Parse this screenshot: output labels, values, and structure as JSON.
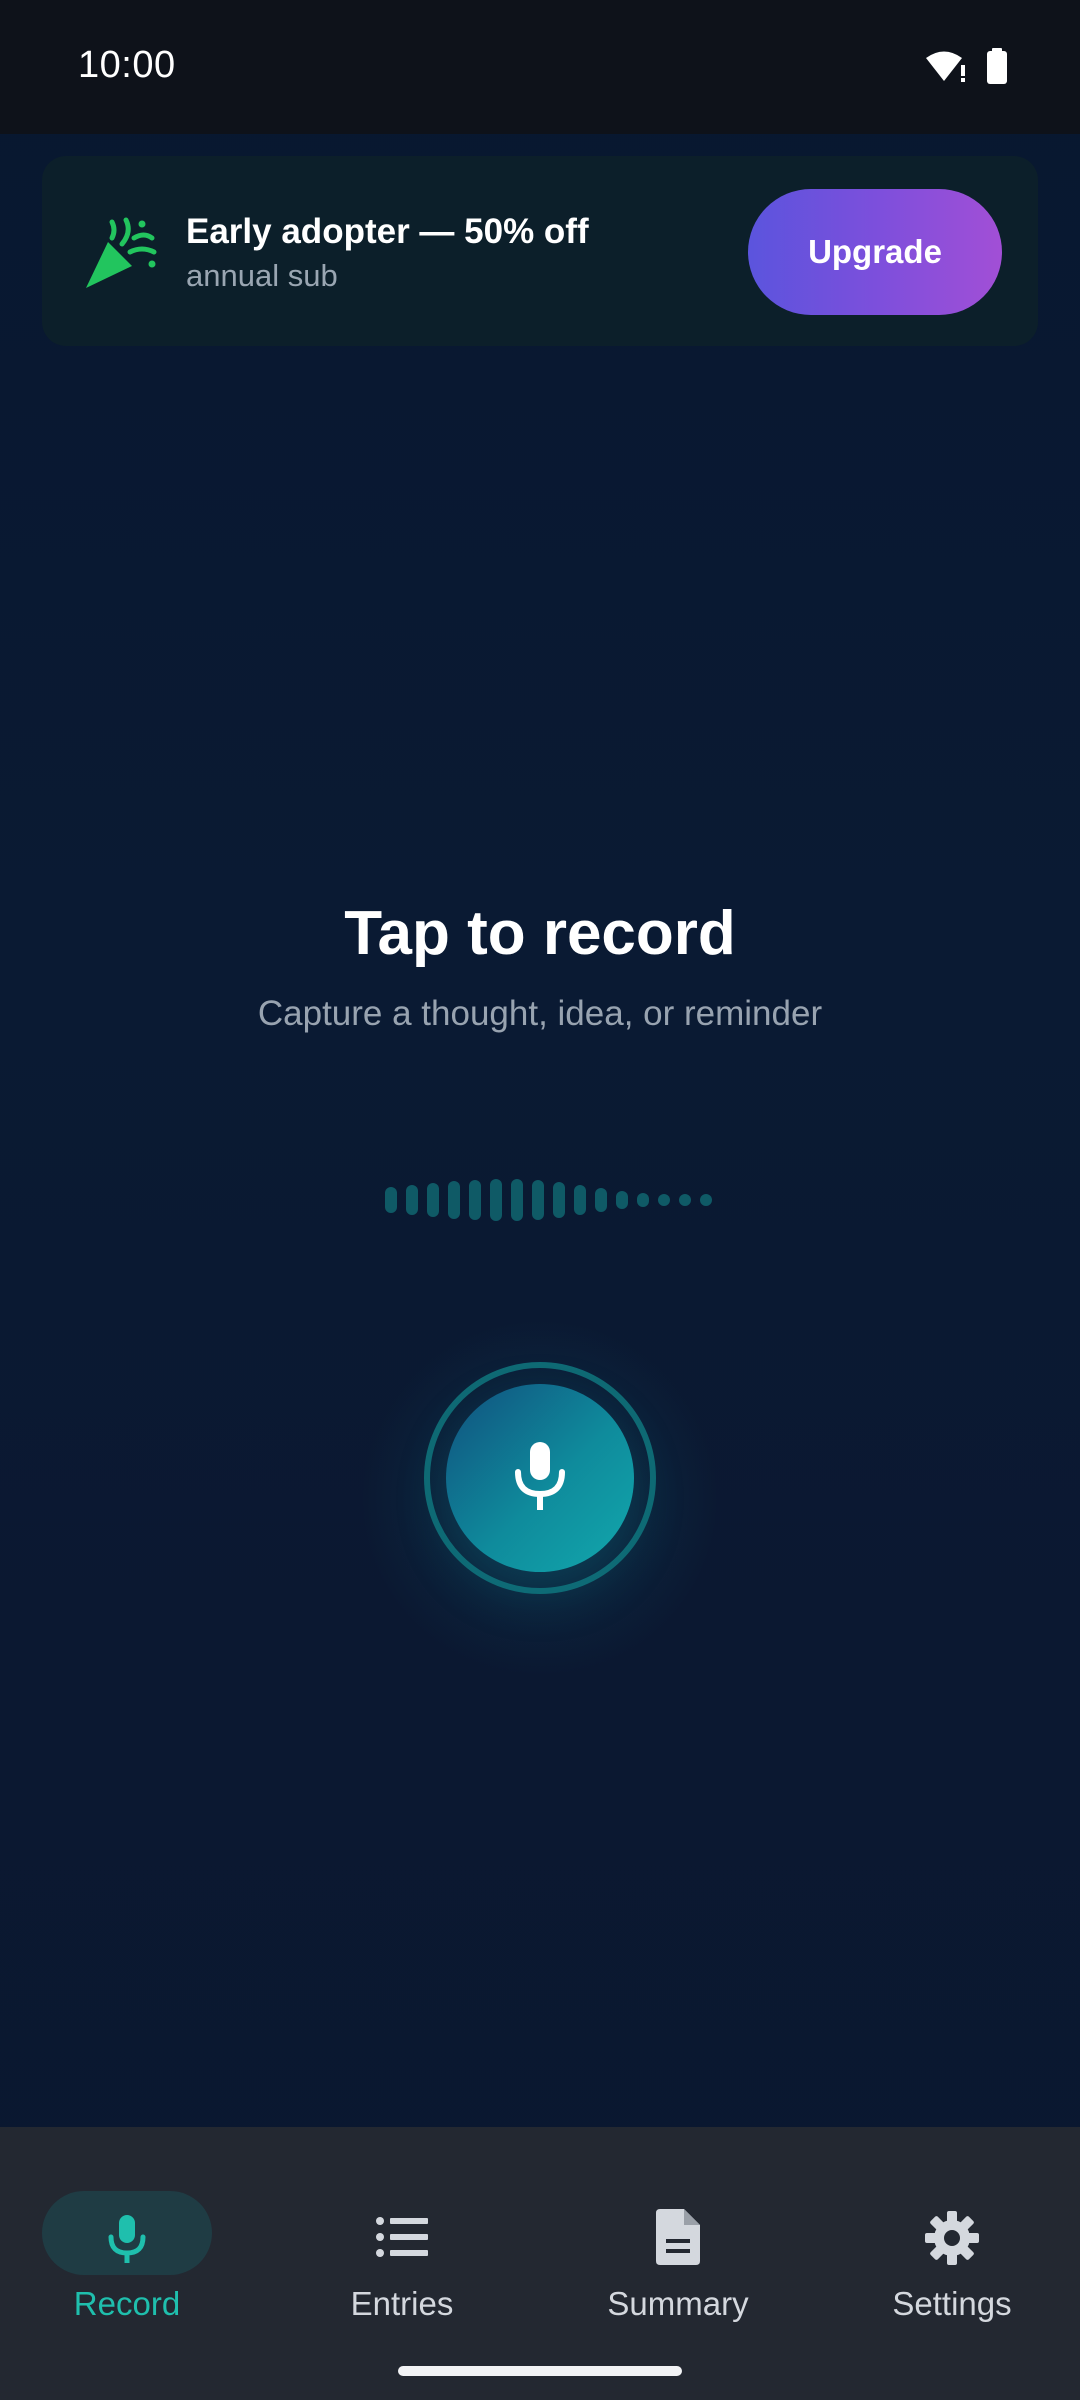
{
  "status_bar": {
    "time": "10:00",
    "icons": [
      "wifi-alert-icon",
      "battery-icon"
    ]
  },
  "promo": {
    "icon": "party-popper-icon",
    "title": "Early adopter — 50% off",
    "subtitle": "annual sub",
    "button_label": "Upgrade"
  },
  "main": {
    "title": "Tap to record",
    "subtitle": "Capture a thought, idea, or reminder",
    "mic_icon": "microphone-icon"
  },
  "nav": {
    "items": [
      {
        "label": "Record",
        "icon": "microphone-icon",
        "active": true
      },
      {
        "label": "Entries",
        "icon": "list-icon",
        "active": false
      },
      {
        "label": "Summary",
        "icon": "document-icon",
        "active": false
      },
      {
        "label": "Settings",
        "icon": "gear-icon",
        "active": false
      }
    ]
  },
  "colors": {
    "accent": "#1fbfad",
    "upgrade_gradient_start": "#5b54dd",
    "upgrade_gradient_end": "#a24fd6",
    "background": "#0a1a33",
    "nav_background": "#232831"
  }
}
